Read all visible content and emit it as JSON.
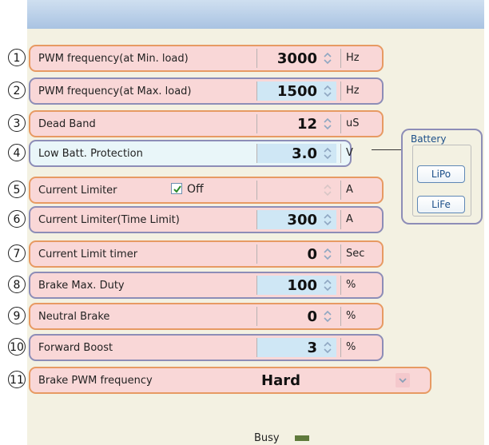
{
  "rows": [
    {
      "num": "1",
      "label": "PWM frequency(at Min. load)",
      "value": "3000",
      "unit": "Hz"
    },
    {
      "num": "2",
      "label": "PWM frequency(at Max. load)",
      "value": "1500",
      "unit": "Hz"
    },
    {
      "num": "3",
      "label": "Dead Band",
      "value": "12",
      "unit": "uS"
    },
    {
      "num": "4",
      "label": "Low Batt. Protection",
      "value": "3.0",
      "unit": "V"
    },
    {
      "num": "5",
      "label": "Current Limiter",
      "value": "",
      "unit": "A",
      "checkbox": {
        "label": "Off",
        "checked": true
      }
    },
    {
      "num": "6",
      "label": "Current Limiter(Time Limit)",
      "value": "300",
      "unit": "A"
    },
    {
      "num": "7",
      "label": "Current Limit timer",
      "value": "0",
      "unit": "Sec"
    },
    {
      "num": "8",
      "label": "Brake Max. Duty",
      "value": "100",
      "unit": "%"
    },
    {
      "num": "9",
      "label": "Neutral Brake",
      "value": "0",
      "unit": "%"
    },
    {
      "num": "10",
      "label": "Forward Boost",
      "value": "3",
      "unit": "%"
    },
    {
      "num": "11",
      "label": "Brake PWM frequency",
      "value": "Hard",
      "unit": ""
    }
  ],
  "battery": {
    "title": "Battery",
    "options": [
      "LiPo",
      "LiFe"
    ]
  },
  "status": {
    "label": "Busy"
  },
  "colors": {
    "orange_border": "#e79a63",
    "blue_border": "#8d8db7",
    "pink": "#f9d7d7",
    "light_blue": "#cfe7f5"
  }
}
